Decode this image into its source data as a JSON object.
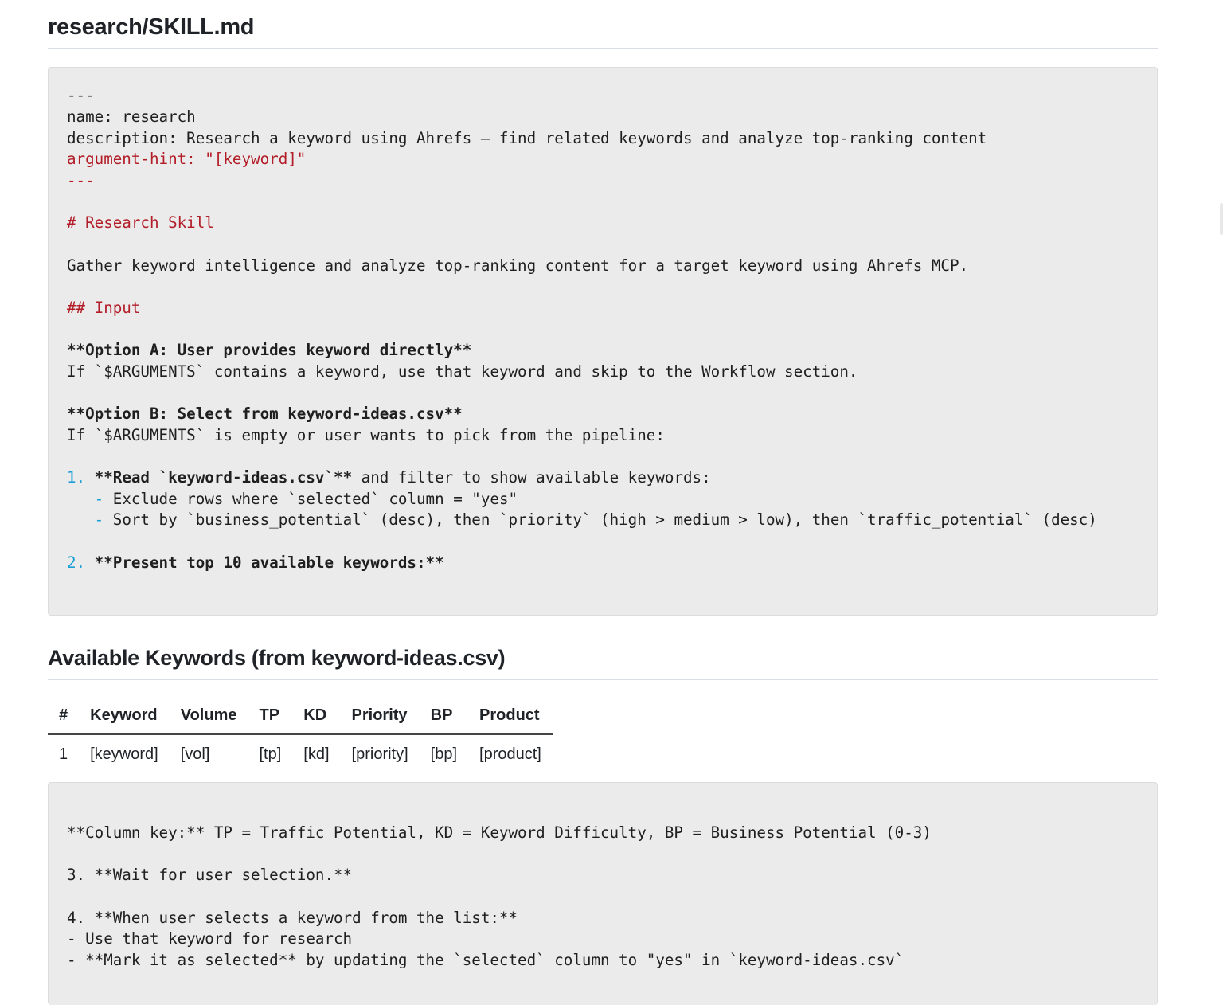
{
  "title": "research/SKILL.md",
  "code1": {
    "lines": [
      "---",
      "name: research",
      "description: Research a keyword using Ahrefs – find related keywords and analyze top-ranking content",
      "argument-hint: \"[keyword]\"",
      "---",
      "# Research Skill",
      "Gather keyword intelligence and analyze top-ranking content for a target keyword using Ahrefs MCP.",
      "## Input",
      "**Option A: User provides keyword directly**",
      "If `$ARGUMENTS` contains a keyword, use that keyword and skip to the Workflow section.",
      "**Option B: Select from keyword-ideas.csv**",
      "If `$ARGUMENTS` is empty or user wants to pick from the pipeline:"
    ],
    "list1": {
      "num": "1.",
      "text_bold": "**Read `keyword-ideas.csv`**",
      "text_rest": " and filter to show available keywords:",
      "sub": [
        "Exclude rows where `selected` column = \"yes\"",
        "Sort by `business_potential` (desc), then `priority` (high > medium > low), then `traffic_potential` (desc)"
      ]
    },
    "list2": {
      "num": "2.",
      "text_bold": "**Present top 10 available keywords:**"
    }
  },
  "section_heading": "Available Keywords (from keyword-ideas.csv)",
  "table": {
    "headers": [
      "#",
      "Keyword",
      "Volume",
      "TP",
      "KD",
      "Priority",
      "BP",
      "Product"
    ],
    "rows": [
      [
        "1",
        "[keyword]",
        "[vol]",
        "[tp]",
        "[kd]",
        "[priority]",
        "[bp]",
        "[product]"
      ]
    ]
  },
  "code2": {
    "lines": [
      "**Column key:** TP = Traffic Potential, KD = Keyword Difficulty, BP = Business Potential (0-3)",
      "3. **Wait for user selection.**",
      "4. **When user selects a keyword from the list:**",
      "- Use that keyword for research",
      "- **Mark it as selected** by updating the `selected` column to \"yes\" in `keyword-ideas.csv`"
    ]
  }
}
